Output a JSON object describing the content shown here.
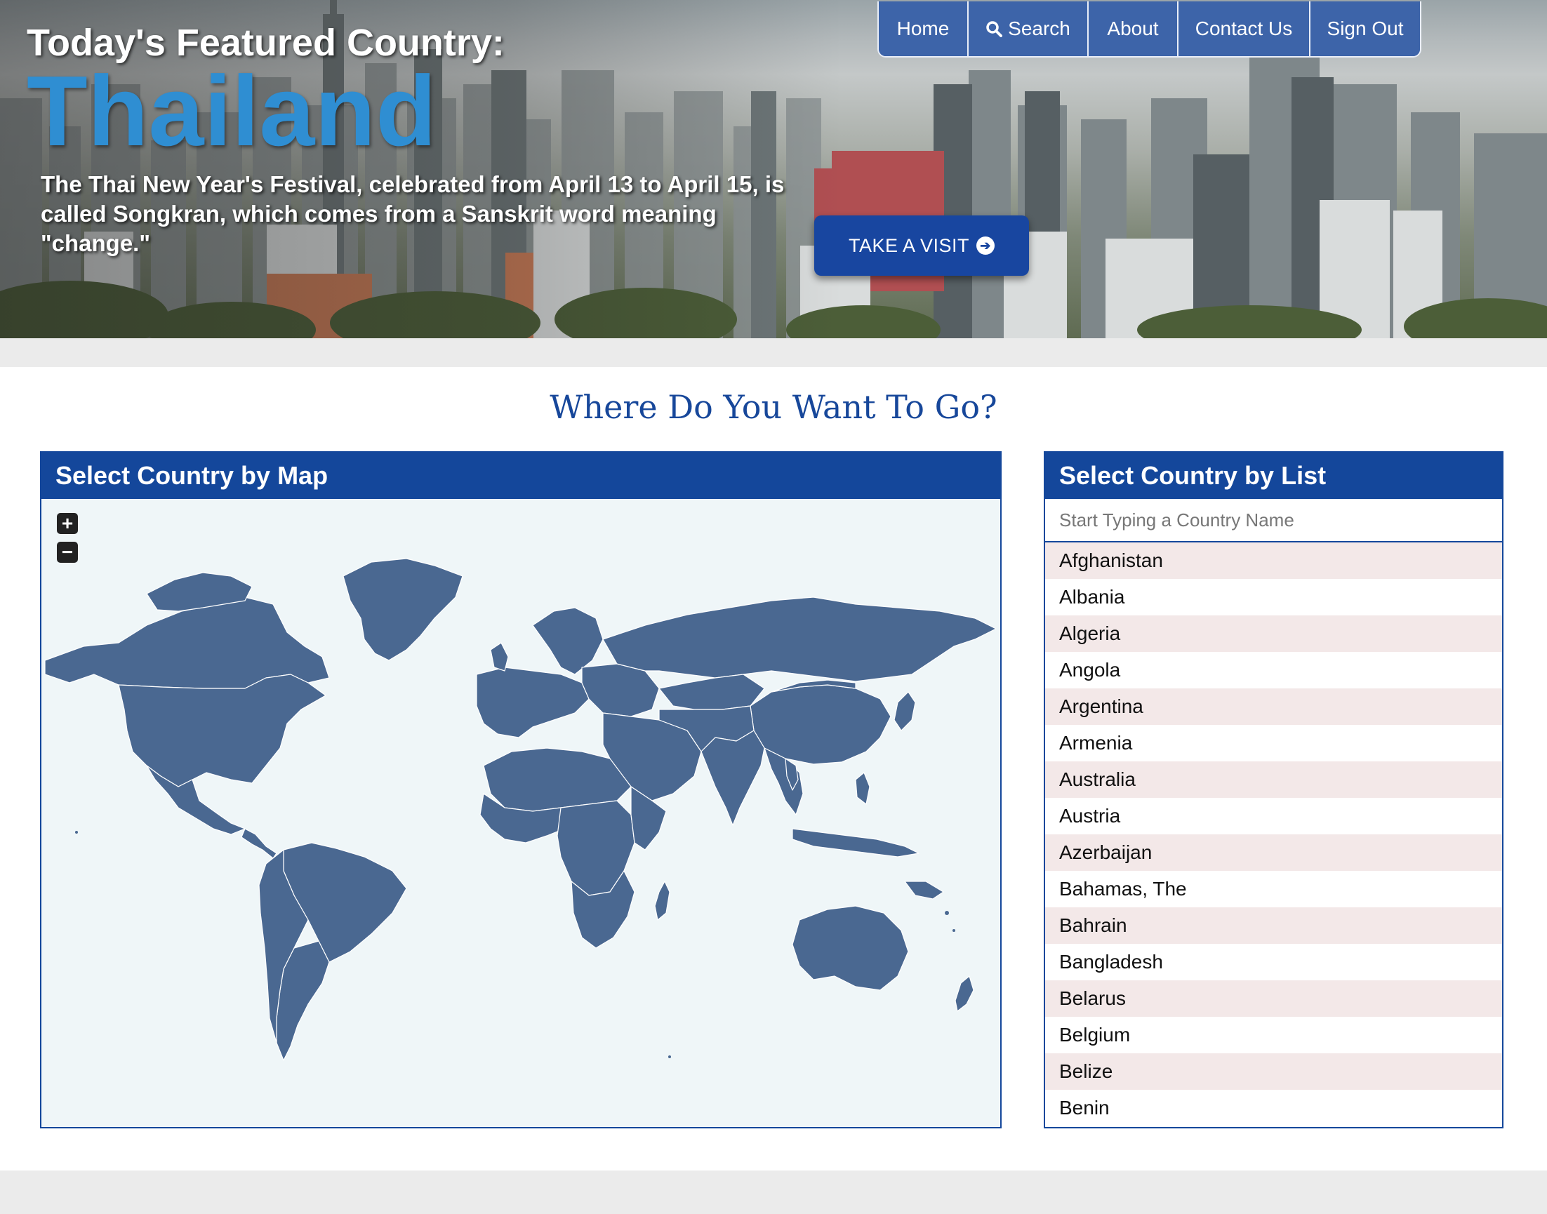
{
  "hero": {
    "label": "Today's Featured Country:",
    "country": "Thailand",
    "fact": "The Thai New Year's Festival, celebrated from April 13 to April 15, is called Songkran, which comes from a Sanskrit word meaning \"change.\"",
    "visit_button": "TAKE A VISIT",
    "visit_icon": "arrow-circle-right-icon"
  },
  "nav": {
    "home": "Home",
    "search": "Search",
    "search_icon": "magnifier-icon",
    "about": "About",
    "contact": "Contact Us",
    "signout": "Sign Out"
  },
  "main": {
    "title": "Where Do You Want To Go?"
  },
  "map_panel": {
    "title": "Select Country by Map",
    "zoom_in": "+",
    "zoom_out": "−"
  },
  "list_panel": {
    "title": "Select Country by List",
    "placeholder": "Start Typing a Country Name",
    "countries": [
      "Afghanistan",
      "Albania",
      "Algeria",
      "Angola",
      "Argentina",
      "Armenia",
      "Australia",
      "Austria",
      "Azerbaijan",
      "Bahamas, The",
      "Bahrain",
      "Bangladesh",
      "Belarus",
      "Belgium",
      "Belize",
      "Benin"
    ]
  },
  "colors": {
    "brand_blue": "#14479b",
    "land": "#4a6891",
    "ocean": "#eff6f8",
    "list_alt_row": "#f3e8e8"
  }
}
